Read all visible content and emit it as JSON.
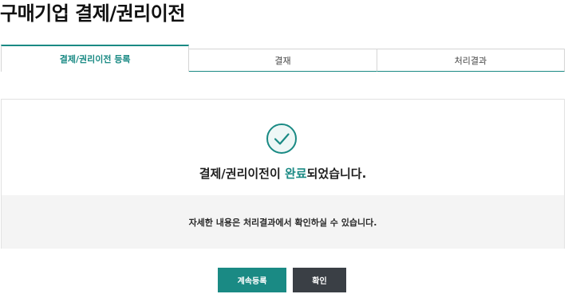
{
  "page": {
    "title": "구매기업 결제/권리이전"
  },
  "tabs": [
    {
      "label": "결제/권리이전 등록",
      "active": true
    },
    {
      "label": "결재",
      "active": false
    },
    {
      "label": "처리결과",
      "active": false
    }
  ],
  "result": {
    "icon": "check-circle-icon",
    "message_prefix": "결제/권리이전이 ",
    "message_highlight": "완료",
    "message_suffix": "되었습니다.",
    "info": "자세한 내용은 처리결과에서 확인하실 수 있습니다."
  },
  "buttons": {
    "continue_label": "계속등록",
    "confirm_label": "확인"
  },
  "colors": {
    "accent": "#1a8a84",
    "dark_button": "#3a3f45",
    "info_background": "#f4f4f4"
  }
}
